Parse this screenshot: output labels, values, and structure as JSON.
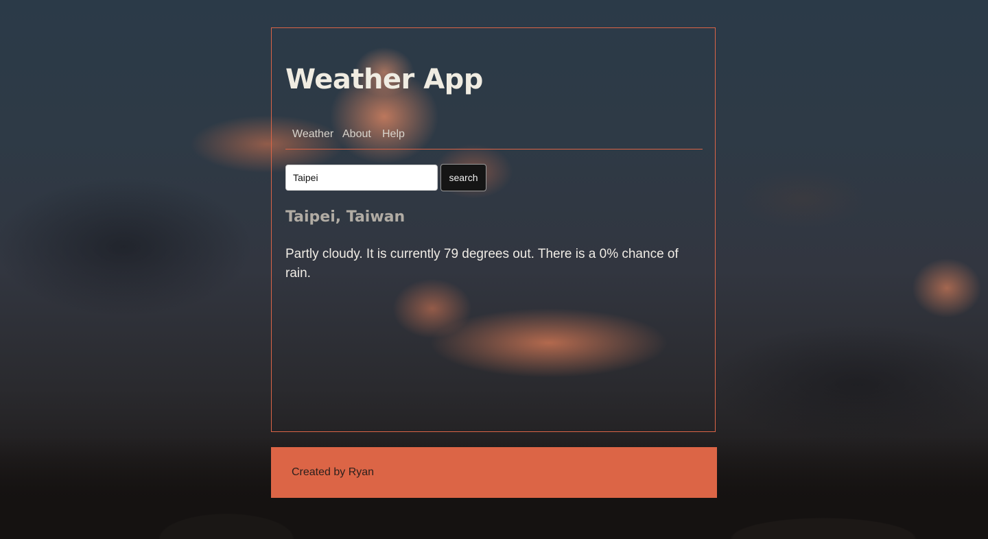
{
  "app": {
    "title": "Weather App"
  },
  "nav": {
    "items": [
      {
        "label": "Weather"
      },
      {
        "label": "About"
      },
      {
        "label": "Help"
      }
    ]
  },
  "search": {
    "value": "Taipei",
    "placeholder": "",
    "button_label": "search"
  },
  "result": {
    "location": "Taipei, Taiwan",
    "forecast": "Partly cloudy. It is currently 79 degrees out. There is a 0% chance of rain."
  },
  "footer": {
    "text": "Created by Ryan"
  },
  "colors": {
    "accent": "#dc6546",
    "title_text": "#f0ece2",
    "location_text": "#b1aca4",
    "button_bg": "#151515"
  }
}
